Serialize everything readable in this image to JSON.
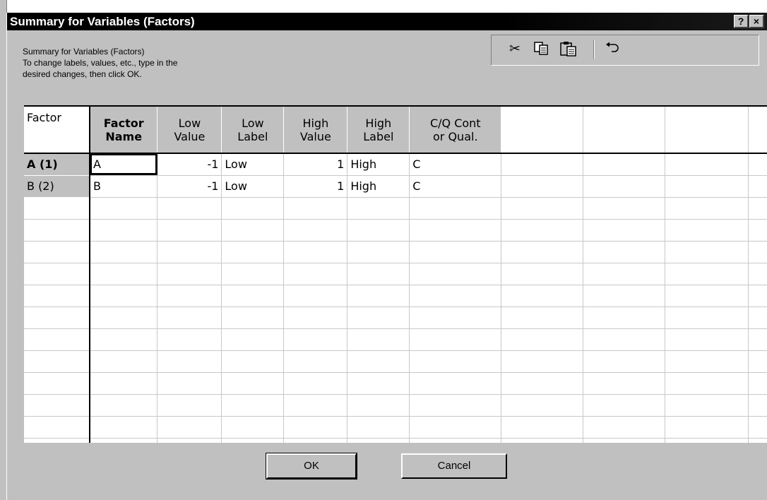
{
  "window": {
    "title": "Summary for Variables (Factors)",
    "help_label": "?",
    "close_label": "×"
  },
  "description": {
    "line1": "Summary for Variables (Factors)",
    "line2": "To change labels, values, etc., type in the",
    "line3": "desired changes, then click OK."
  },
  "toolbar": {
    "cut_icon": "scissors-icon",
    "copy_icon": "copy-icon",
    "paste_icon": "paste-icon",
    "undo_icon": "undo-icon"
  },
  "grid": {
    "row_header_title": "Factor",
    "columns": [
      {
        "line1": "Factor",
        "line2": "Name"
      },
      {
        "line1": "Low",
        "line2": "Value"
      },
      {
        "line1": "Low",
        "line2": "Label"
      },
      {
        "line1": "High",
        "line2": "Value"
      },
      {
        "line1": "High",
        "line2": "Label"
      },
      {
        "line1": "C/Q Cont",
        "line2": "or Qual."
      }
    ],
    "rows": [
      {
        "header": "A  (1)",
        "name": "A",
        "low_value": "-1",
        "low_label": "Low",
        "high_value": "1",
        "high_label": "High",
        "cq": "C"
      },
      {
        "header": "B  (2)",
        "name": "B",
        "low_value": "-1",
        "low_label": "Low",
        "high_value": "1",
        "high_label": "High",
        "cq": "C"
      }
    ]
  },
  "buttons": {
    "ok": "OK",
    "cancel": "Cancel"
  }
}
